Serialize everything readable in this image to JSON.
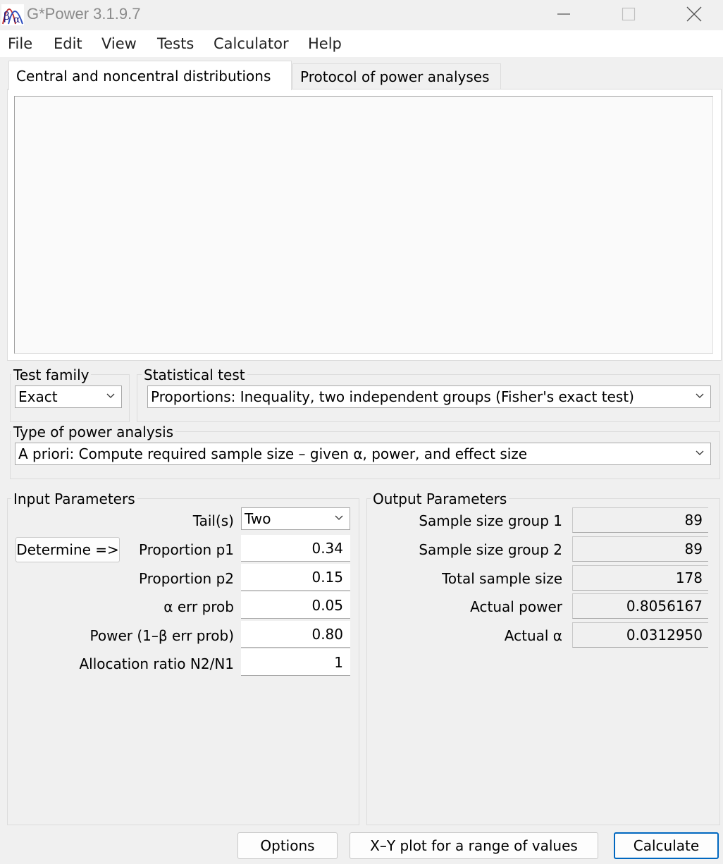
{
  "window": {
    "title": "G*Power 3.1.9.7"
  },
  "menu": [
    "File",
    "Edit",
    "View",
    "Tests",
    "Calculator",
    "Help"
  ],
  "tabs": [
    {
      "label": "Central and noncentral distributions",
      "active": true
    },
    {
      "label": "Protocol of power analyses",
      "active": false
    }
  ],
  "test_family": {
    "label": "Test family",
    "value": "Exact"
  },
  "statistical_test": {
    "label": "Statistical test",
    "value": "Proportions: Inequality, two independent groups (Fisher's exact test)"
  },
  "power_analysis": {
    "label": "Type of power analysis",
    "value": "A priori: Compute required sample size – given α, power, and effect size"
  },
  "input": {
    "title": "Input Parameters",
    "determine_label": "Determine =>",
    "tails": {
      "label": "Tail(s)",
      "value": "Two"
    },
    "p1": {
      "label": "Proportion p1",
      "value": "0.34"
    },
    "p2": {
      "label": "Proportion p2",
      "value": "0.15"
    },
    "alpha": {
      "label": "α err prob",
      "value": "0.05"
    },
    "power": {
      "label": "Power (1–β err prob)",
      "value": "0.80"
    },
    "allocation": {
      "label": "Allocation ratio N2/N1",
      "value": "1"
    }
  },
  "output": {
    "title": "Output Parameters",
    "group1": {
      "label": "Sample size group 1",
      "value": "89"
    },
    "group2": {
      "label": "Sample size group 2",
      "value": "89"
    },
    "total": {
      "label": "Total sample size",
      "value": "178"
    },
    "actual_power": {
      "label": "Actual power",
      "value": "0.8056167"
    },
    "actual_alpha": {
      "label": "Actual α",
      "value": "0.0312950"
    }
  },
  "buttons": {
    "options": "Options",
    "xy_plot": "X–Y plot for a range of values",
    "calculate": "Calculate"
  },
  "colors": {
    "accent": "#0067c0",
    "window_bg": "#f0f0f0"
  }
}
